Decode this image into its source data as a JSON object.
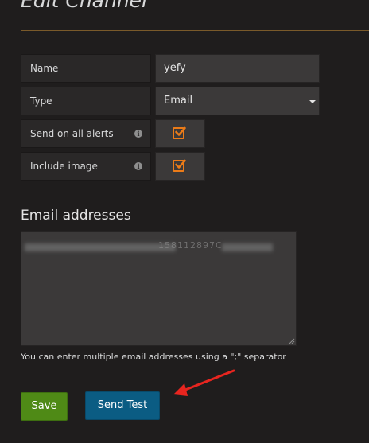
{
  "page": {
    "title": "Edit Channel"
  },
  "form": {
    "name_label": "Name",
    "name_value": "yefy",
    "type_label": "Type",
    "type_value": "Email",
    "send_all_label": "Send on all alerts",
    "send_all_checked": true,
    "include_image_label": "Include image",
    "include_image_checked": true
  },
  "email": {
    "section_title": "Email addresses",
    "partial_visible_text": "158112897C",
    "help_text": "You can enter multiple email addresses using a \";\" separator"
  },
  "buttons": {
    "save_label": "Save",
    "send_test_label": "Send Test"
  },
  "colors": {
    "background": "#1f1d1d",
    "checkbox_accent": "#eb7b18",
    "save_button": "#4f8a16",
    "send_test_button": "#0b5c83",
    "annotation_arrow": "#e8251f"
  },
  "icons": {
    "info": "info-circle-icon",
    "checkmark": "check-icon",
    "dropdown": "caret-down-icon",
    "annotation": "red-arrow-icon"
  }
}
